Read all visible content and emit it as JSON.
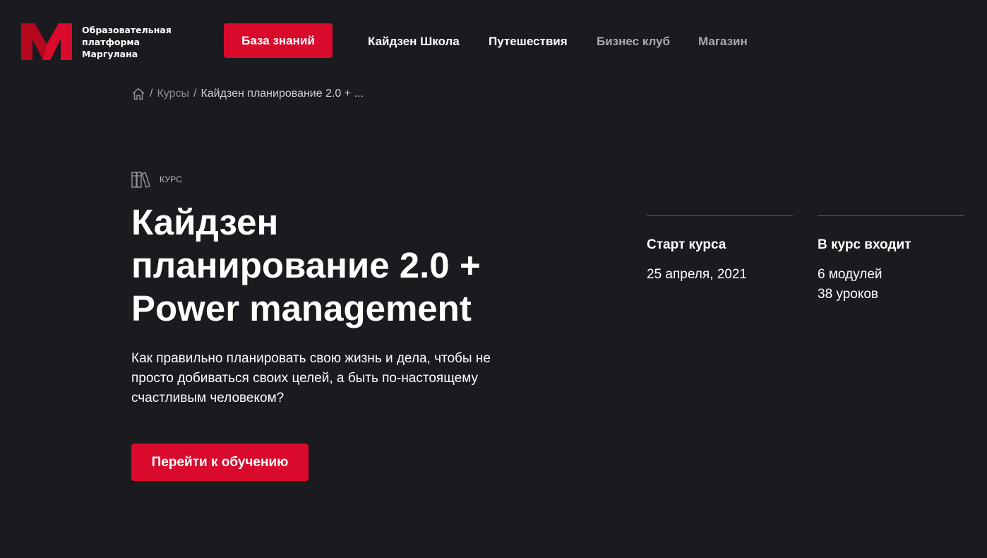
{
  "header": {
    "logo_text_line1": "Образовательная",
    "logo_text_line2": "платформа",
    "logo_text_line3": "Маргулана",
    "knowledge_button": "База знаний",
    "nav": [
      {
        "label": "Кайдзен Школа",
        "state": "active"
      },
      {
        "label": "Путешествия",
        "state": "active"
      },
      {
        "label": "Бизнес клуб",
        "state": "muted"
      },
      {
        "label": "Магазин",
        "state": "muted"
      }
    ]
  },
  "breadcrumb": {
    "home_icon": "home-icon",
    "separator": "/",
    "items": [
      "Курсы",
      "Кайдзен планирование 2.0 + ..."
    ]
  },
  "course": {
    "tag_icon": "books-icon",
    "tag_label": "КУРС",
    "title_line1": "Кайдзен",
    "title_line2": "планирование 2.0 +",
    "title_line3": "Power management",
    "description": "Как правильно планировать свою жизнь и дела, чтобы не просто добиваться своих целей, а быть по-настоящему счастливым человеком?",
    "cta_button": "Перейти к обучению"
  },
  "info": {
    "start": {
      "heading": "Старт курса",
      "value": "25 апреля, 2021"
    },
    "includes": {
      "heading": "В курс входит",
      "modules": "6 модулей",
      "lessons": "38 уроков"
    }
  },
  "colors": {
    "background": "#1b1a1f",
    "accent": "#d90a2c",
    "muted_text": "#a9a9ae"
  }
}
